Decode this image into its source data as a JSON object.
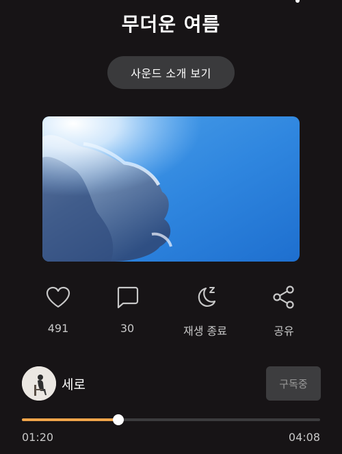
{
  "player": {
    "title": "무더운 여름",
    "intro_button": "사운드 소개 보기"
  },
  "actions": {
    "like": {
      "icon": "heart-icon",
      "label": "491"
    },
    "comment": {
      "icon": "comment-icon",
      "label": "30"
    },
    "sleep_timer": {
      "icon": "moon-sleep-icon",
      "label": "재생 종료"
    },
    "share": {
      "icon": "share-icon",
      "label": "공유"
    }
  },
  "artist": {
    "name": "세로",
    "subscribe_label": "구독중"
  },
  "playback": {
    "current_time": "01:20",
    "total_time": "04:08",
    "progress_fraction": 0.323
  },
  "colors": {
    "background": "#171416",
    "accent": "#f0a54a",
    "button_bg": "#3a3a3c"
  }
}
